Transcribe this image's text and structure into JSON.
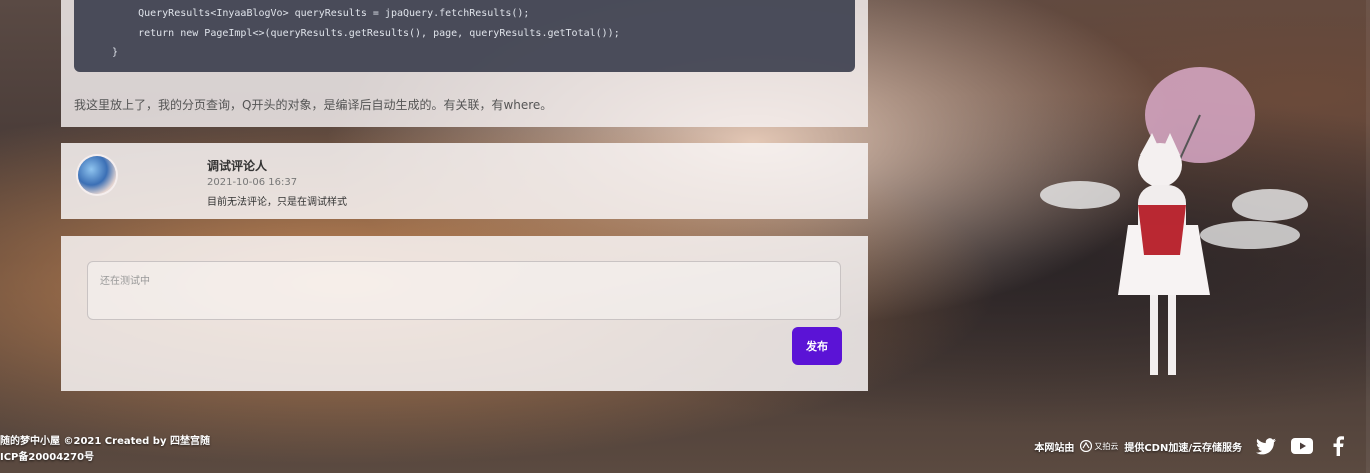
{
  "post": {
    "code_lines": [
      "    QueryResults<InyaaBlogVo> queryResults = jpaQuery.fetchResults();",
      "    return new PageImpl<>(queryResults.getResults(), page, queryResults.getTotal());",
      "}"
    ],
    "paragraph": "我这里放上了，我的分页查询，Q开头的对象，是编译后自动生成的。有关联，有where。"
  },
  "comment": {
    "author": "调试评论人",
    "time": "2021-10-06 16:37",
    "body": "目前无法评论，只是在调试样式"
  },
  "reply": {
    "placeholder": "还在测试中",
    "submit_label": "发布"
  },
  "footer": {
    "copyright": "随的梦中小屋 ©2021 Created by 四埜宫随",
    "icp": "ICP备20004270号",
    "hosting_prefix": "本网站由",
    "provider_name": "又拍云",
    "hosting_suffix": "提供CDN加速/云存储服务",
    "social_icons": [
      "twitter-icon",
      "youtube-icon",
      "facebook-icon"
    ]
  },
  "colors": {
    "accent": "#5b13d6",
    "card_bg": "#f6f2f2"
  }
}
